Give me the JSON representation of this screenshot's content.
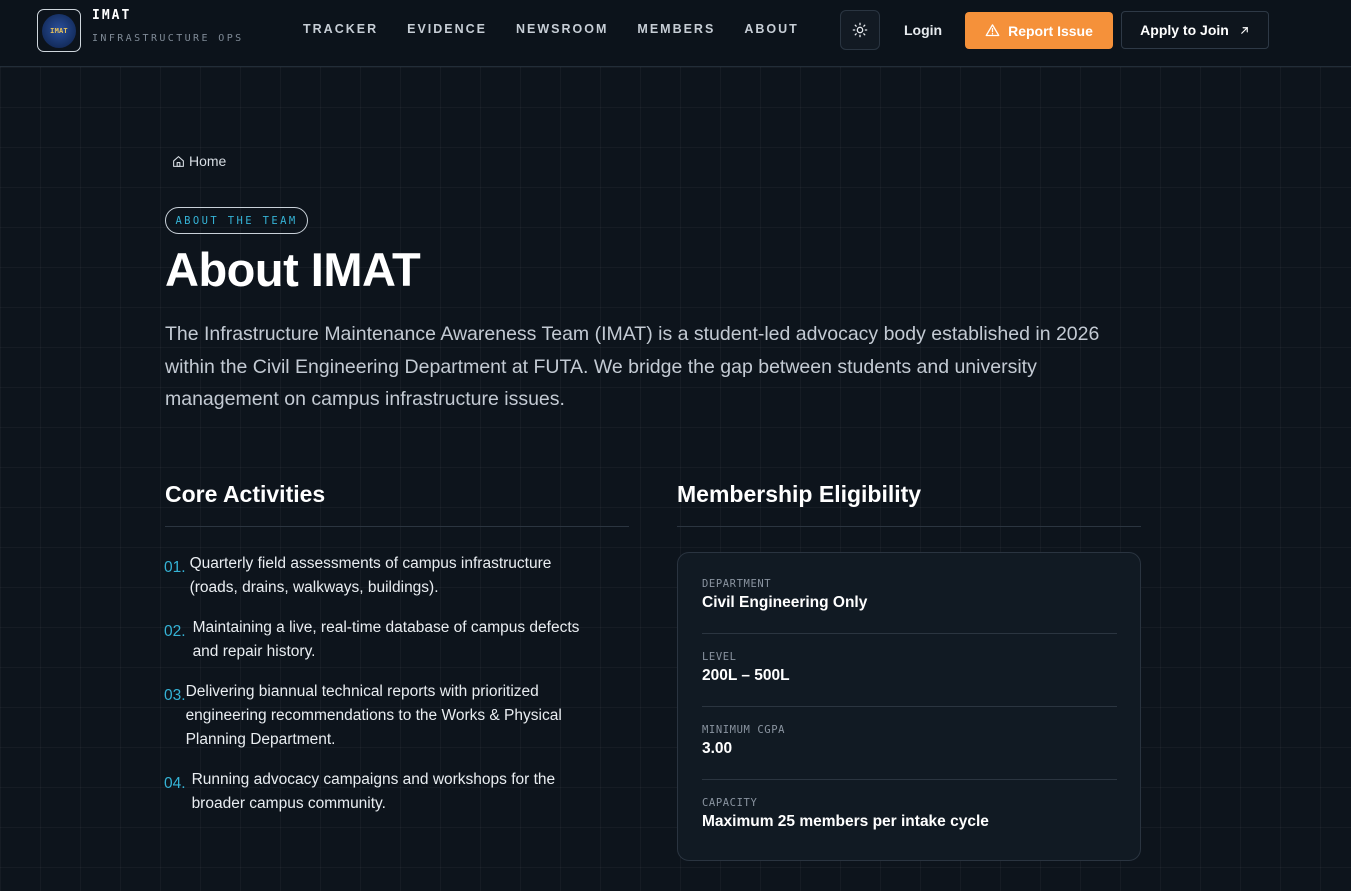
{
  "header": {
    "logo_text": "IMAT",
    "brand_name": "IMAT",
    "brand_sub": "INFRASTRUCTURE OPS",
    "nav": [
      "TRACKER",
      "EVIDENCE",
      "NEWSROOM",
      "MEMBERS",
      "ABOUT"
    ],
    "login_label": "Login",
    "report_label": "Report Issue",
    "apply_label": "Apply to Join"
  },
  "breadcrumb": {
    "home_label": "Home"
  },
  "hero": {
    "pill": "ABOUT THE TEAM",
    "title": "About IMAT",
    "intro": "The Infrastructure Maintenance Awareness Team (IMAT) is a student-led advocacy body established in 2026 within the Civil Engineering Department at FUTA. We bridge the gap between students and university management on campus infrastructure issues."
  },
  "activities": {
    "title": "Core Activities",
    "items": [
      {
        "num": "01.",
        "text_l1": "Quarterly field assessments of campus infrastructure",
        "text_l2": "(roads, drains, walkways, buildings)."
      },
      {
        "num": "02.",
        "text_l1": "Maintaining a live, real-time database of campus defects",
        "text_l2": "and repair history."
      },
      {
        "num": "03.",
        "text_l1": "Delivering biannual technical reports with prioritized",
        "text_l2": "engineering recommendations to the Works & Physical",
        "text_l3": "Planning Department."
      },
      {
        "num": "04.",
        "text_l1": "Running advocacy campaigns and workshops for the",
        "text_l2": "broader campus community."
      }
    ]
  },
  "eligibility": {
    "title": "Membership Eligibility",
    "rows": [
      {
        "label": "DEPARTMENT",
        "value": "Civil Engineering Only"
      },
      {
        "label": "LEVEL",
        "value": "200L – 500L"
      },
      {
        "label": "MINIMUM CGPA",
        "value": "3.00"
      },
      {
        "label": "CAPACITY",
        "value": "Maximum 25 members per intake cycle"
      }
    ]
  },
  "colors": {
    "background": "#0d141c",
    "accent_cyan": "#35b3d6",
    "accent_orange": "#f5913a"
  },
  "icons": [
    "sun-icon",
    "warning-triangle-icon",
    "arrow-up-right-icon",
    "home-icon"
  ]
}
